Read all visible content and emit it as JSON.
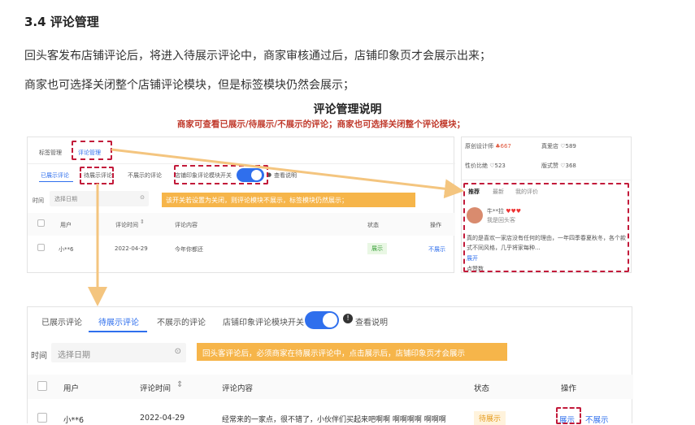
{
  "heading": "3.4 评论管理",
  "para1": "回头客发布店铺评论后，将进入待展示评论中，商家审核通过后，店铺印象页才会展示出来；",
  "para2": "商家也可选择关闭整个店铺评论模块，但是标签模块仍然会展示；",
  "figure": {
    "title": "评论管理说明",
    "subtitle": "商家可查看已展示/待展示/不展示的评论；商家也可选择关闭整个评论模块；"
  },
  "small_panel": {
    "top_tabs": [
      "标签管理",
      "评论管理"
    ],
    "sub_tabs": [
      "已展示评论",
      "待展示评论",
      "不展示的评论"
    ],
    "toggle_label": "店铺印象评论模块开关",
    "help": "查看说明",
    "time_label": "时间",
    "date_placeholder": "选择日期",
    "note": "该开关若设置为关闭，则评论模块不展示，标签模块仍然展示；",
    "columns": [
      "用户",
      "评论时间",
      "评论内容",
      "状态",
      "操作"
    ],
    "row": {
      "user": "小**6",
      "date": "2022-04-29",
      "content": "今年你都还",
      "status": "展示",
      "action": "不展示"
    }
  },
  "phone": {
    "tags": [
      {
        "label": "原创设计师",
        "count": "667"
      },
      {
        "label": "真爱店",
        "count": "589"
      },
      {
        "label": "性价比绝",
        "count": "523"
      },
      {
        "label": "版式赞",
        "count": "368"
      }
    ],
    "tabs": [
      "推荐",
      "最新",
      "我的评价"
    ],
    "user_name": "牛**拉",
    "user_sub": "我是回头客",
    "hearts": "♥♥♥",
    "comment": "真的是喜欢一家店没有任何的理由，一年四季春夏秋冬，各个款式不同风格，几乎将家每种...",
    "expand": "展开",
    "likes": "点赞数"
  },
  "big_panel": {
    "sub_tabs": [
      "已展示评论",
      "待展示评论",
      "不展示的评论"
    ],
    "toggle_label": "店铺印象评论模块开关",
    "help": "查看说明",
    "time_label": "时间",
    "date_placeholder": "选择日期",
    "note": "回头客评论后，必须商家在待展示评论中，点击展示后，店铺印象页才会展示",
    "columns": [
      "用户",
      "评论时间",
      "评论内容",
      "状态",
      "操作"
    ],
    "row": {
      "user": "小**6",
      "date": "2022-04-29",
      "content": "经常来的一家点，很不错了，小伙伴们买起来吧啊啊 啊啊啊啊 啊啊啊",
      "status": "待展示",
      "action_show": "展示",
      "action_hide": "不展示"
    }
  },
  "colors": {
    "accent": "#2f6fed",
    "dash": "#c21a3a",
    "note": "#f6b54a",
    "arrow": "#f4c57f"
  }
}
